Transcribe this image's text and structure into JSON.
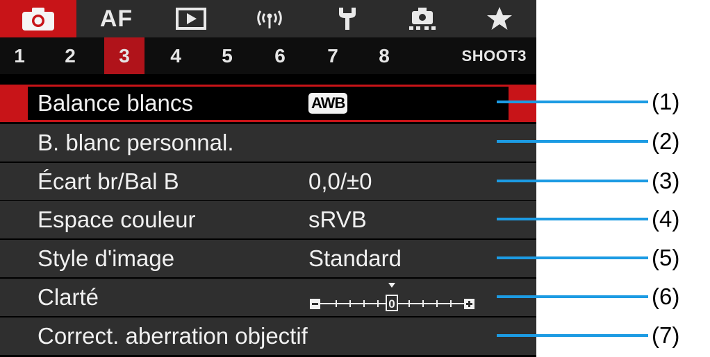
{
  "topbar": {
    "tabs": [
      {
        "id": "shoot",
        "icon": "camera-icon",
        "active": true
      },
      {
        "id": "af",
        "label": "AF"
      },
      {
        "id": "playback",
        "icon": "playback-icon"
      },
      {
        "id": "wireless",
        "icon": "wireless-icon"
      },
      {
        "id": "setup",
        "icon": "wrench-icon"
      },
      {
        "id": "custom",
        "icon": "custom-functions-icon"
      },
      {
        "id": "mymenu",
        "icon": "star-icon"
      }
    ]
  },
  "subtabs": {
    "numbers": [
      "1",
      "2",
      "3",
      "4",
      "5",
      "6",
      "7",
      "8"
    ],
    "active_index": 2,
    "section_label": "SHOOT3"
  },
  "menu_items": [
    {
      "label": "Balance blancs",
      "value": "AWB",
      "callout": "(1)"
    },
    {
      "label": "B. blanc personnal.",
      "value": "",
      "callout": "(2)"
    },
    {
      "label": "Écart br/Bal B",
      "value": "0,0/±0",
      "callout": "(3)"
    },
    {
      "label": "Espace couleur",
      "value": "sRVB",
      "callout": "(4)"
    },
    {
      "label": "Style d'image",
      "value": "Standard",
      "callout": "(5)"
    },
    {
      "label": "Clarté",
      "value": "0",
      "callout": "(6)"
    },
    {
      "label": "Correct. aberration objectif",
      "value": "",
      "callout": "(7)"
    }
  ],
  "colors": {
    "accent": "#c81418",
    "callout_line": "#1c9be3"
  }
}
